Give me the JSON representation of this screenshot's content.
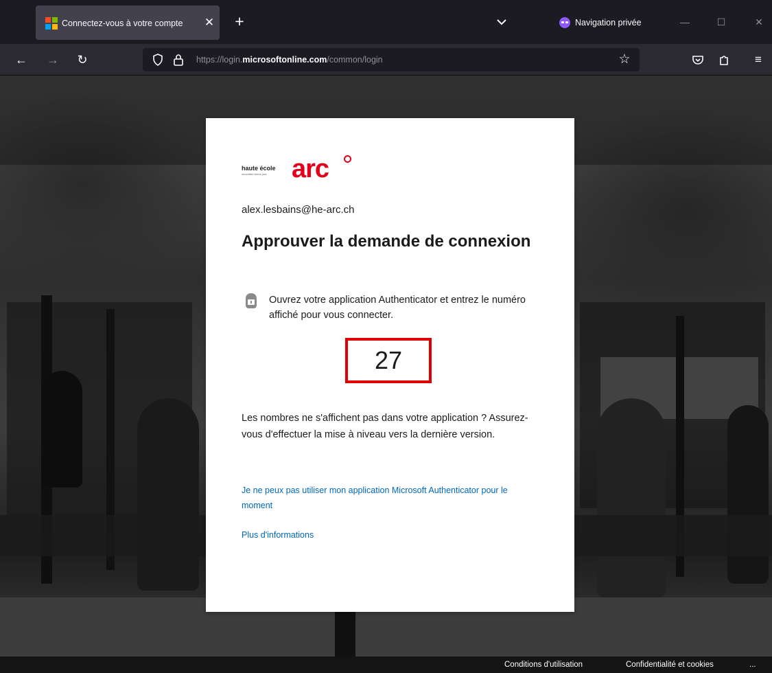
{
  "browser": {
    "tab": {
      "title": "Connectez-vous à votre compte",
      "close_glyph": "✕"
    },
    "new_tab_glyph": "+",
    "tab_list_icon": "chevron-down-icon",
    "private_label": "Navigation privée",
    "window": {
      "minimize": "—",
      "maximize": "☐",
      "close": "✕"
    },
    "nav": {
      "back": "←",
      "forward": "→",
      "reload": "↻"
    },
    "url": {
      "prefix": "https://login.",
      "domain": "microsoftonline.com",
      "path": "/common/login"
    },
    "star_glyph": "☆",
    "toolbar": {
      "pocket_icon": "pocket-icon",
      "extensions_icon": "extensions-icon",
      "menu_glyph": "≡"
    }
  },
  "card": {
    "logo": {
      "small_text": "haute école",
      "tiny_text": "neuchâtel berne jura",
      "brand": "arc"
    },
    "email": "alex.lesbains@he-arc.ch",
    "title": "Approuver la demande de connexion",
    "instruction": "Ouvrez votre application Authenticator et entrez le numéro affiché pour vous connecter.",
    "number": "27",
    "help_text": "Les nombres ne s'affichent pas dans votre application ? Assurez-vous d'effectuer la mise à niveau vers la dernière version.",
    "link_cannot_use": "Je ne peux pas utiliser mon application Microsoft Authenticator pour le moment",
    "link_more_info": "Plus d'informations"
  },
  "footer": {
    "terms": "Conditions d'utilisation",
    "privacy": "Confidentialité et cookies",
    "more": "..."
  },
  "colors": {
    "brand_red": "#e3001b",
    "link_blue": "#0067b8",
    "highlight": "#e00000",
    "private_purple": "#9059ff"
  }
}
